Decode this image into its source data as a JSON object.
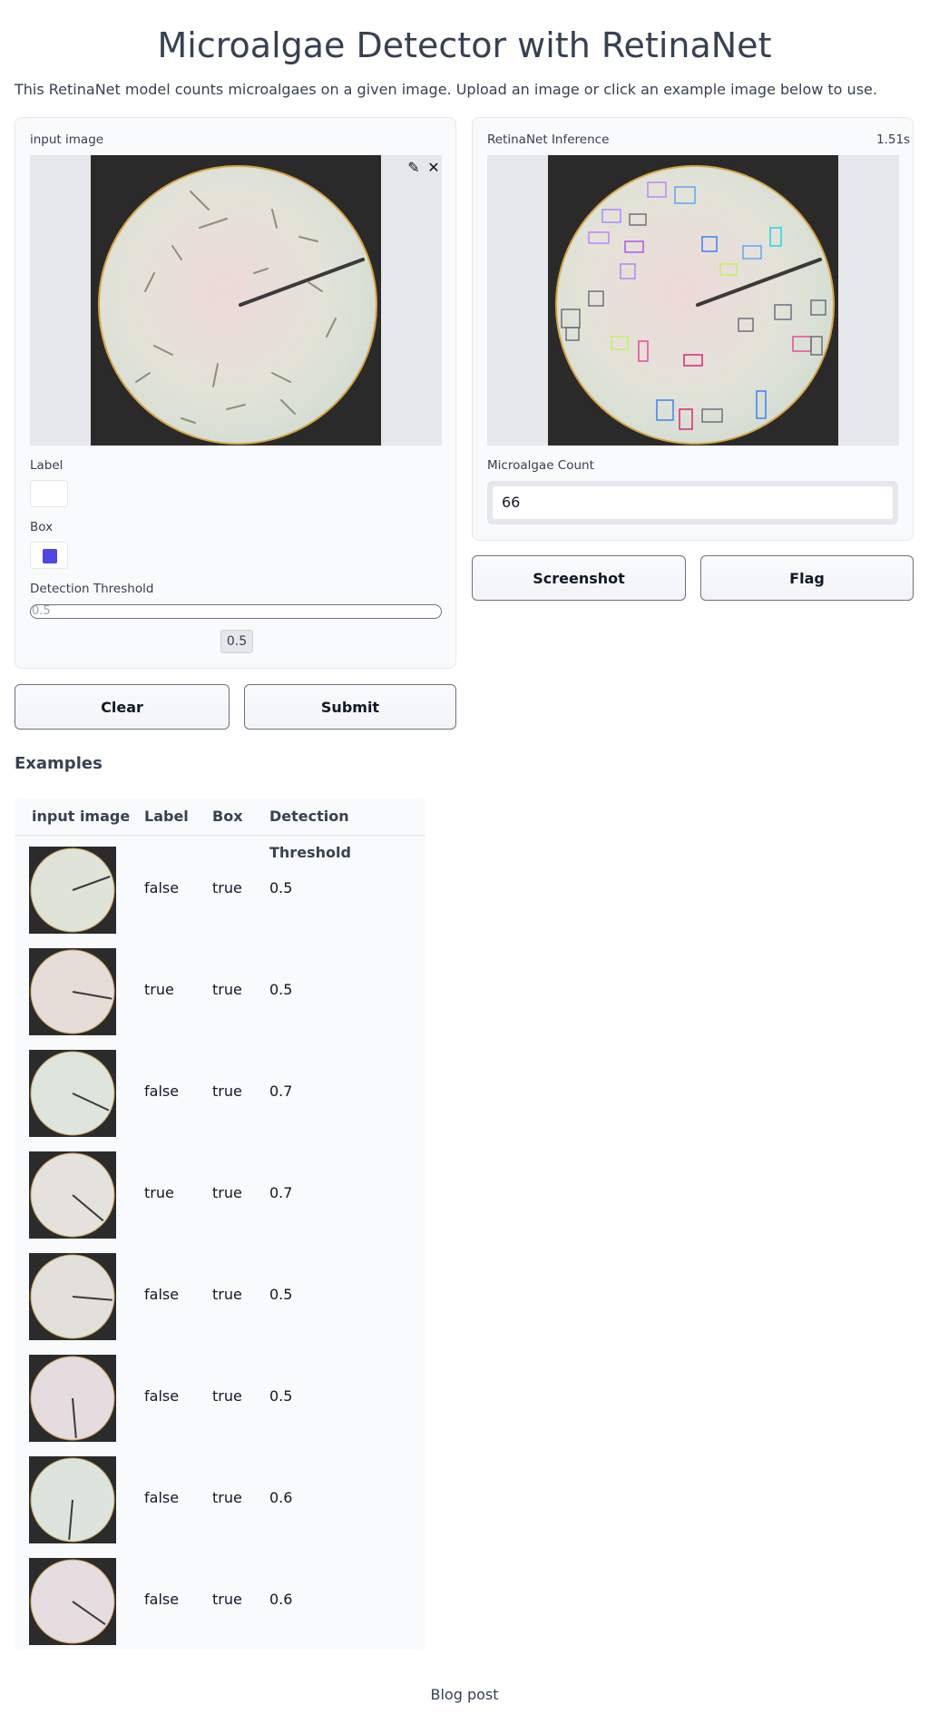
{
  "app": {
    "title": "Microalgae Detector with RetinaNet",
    "description": "This RetinaNet model counts microalgaes on a given image. Upload an image or click an example image below to use."
  },
  "input_panel": {
    "image_label": "input image",
    "edit_icon": "pencil-icon",
    "clear_icon": "close-icon",
    "label_checkbox": {
      "label": "Label",
      "checked": false
    },
    "box_checkbox": {
      "label": "Box",
      "checked": true,
      "color": "#4f46e5"
    },
    "threshold": {
      "label": "Detection Threshold",
      "value": "0.5",
      "value_display": "0.5"
    }
  },
  "output_panel": {
    "image_label": "RetinaNet Inference",
    "timing": "1.51s",
    "count_label": "Microalgae Count",
    "count_value": "66"
  },
  "buttons": {
    "clear": "Clear",
    "submit": "Submit",
    "screenshot": "Screenshot",
    "flag": "Flag"
  },
  "examples": {
    "title": "Examples",
    "headers": [
      "input image",
      "Label",
      "Box",
      "Detection Threshold"
    ],
    "rows": [
      {
        "label": "false",
        "box": "true",
        "threshold": "0.5"
      },
      {
        "label": "true",
        "box": "true",
        "threshold": "0.5"
      },
      {
        "label": "false",
        "box": "true",
        "threshold": "0.7"
      },
      {
        "label": "true",
        "box": "true",
        "threshold": "0.7"
      },
      {
        "label": "false",
        "box": "true",
        "threshold": "0.5"
      },
      {
        "label": "false",
        "box": "true",
        "threshold": "0.5"
      },
      {
        "label": "false",
        "box": "true",
        "threshold": "0.6"
      },
      {
        "label": "false",
        "box": "true",
        "threshold": "0.6"
      }
    ]
  },
  "footer": {
    "link": "Blog post"
  },
  "colors": {
    "accent": "#4f46e5",
    "panel_bg": "#f9fafb",
    "border": "#e5e7eb"
  }
}
